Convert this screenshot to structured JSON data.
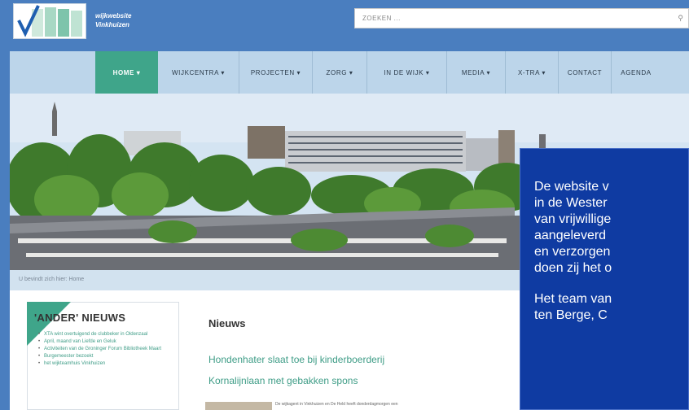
{
  "header": {
    "logo_line1": "wijkwebsite",
    "logo_line2": "Vinkhuizen",
    "search_placeholder": "ZOEKEN ..."
  },
  "nav": {
    "items": [
      {
        "label": "HOME ▾",
        "active": true
      },
      {
        "label": "WIJKCENTRA ▾",
        "active": false
      },
      {
        "label": "PROJECTEN ▾",
        "active": false
      },
      {
        "label": "ZORG ▾",
        "active": false
      },
      {
        "label": "IN DE WIJK ▾",
        "active": false
      },
      {
        "label": "MEDIA ▾",
        "active": false
      },
      {
        "label": "X-TRA ▾",
        "active": false
      },
      {
        "label": "CONTACT",
        "active": false
      },
      {
        "label": "AGENDA",
        "active": false
      }
    ]
  },
  "breadcrumb": "U bevindt zich hier: Home",
  "sidebar": {
    "title": "'ANDER' NIEUWS",
    "items": [
      "XTA wint overtuigend de clubbeker in Oldenzaal",
      "April, maand van Liefde en Geluk",
      "Activiteiten van de Groninger Forum Bibliotheek Maart",
      "Burgemeester bezoekt",
      "het wijkteamhuis Vinkhuizen"
    ]
  },
  "news": {
    "heading": "Nieuws",
    "links": [
      "Hondenhater slaat toe bij kinderboerderij",
      "Kornalijnlaan met gebakken spons"
    ],
    "snippet": "De wijkagent in Vinkhuizen en De Held heeft donderdagmorgen een"
  },
  "overlay": {
    "lines": [
      "De website v",
      "in de Wester",
      "van vrijwillige",
      "aangeleverd",
      "en verzorgen",
      "doen zij het o",
      "",
      "Het team van",
      "ten Berge, C"
    ]
  },
  "colors": {
    "header_blue": "#4a7ebf",
    "nav_bg": "#bcd5ea",
    "accent_green": "#3fa58a",
    "overlay_blue": "#0f3ba2"
  }
}
